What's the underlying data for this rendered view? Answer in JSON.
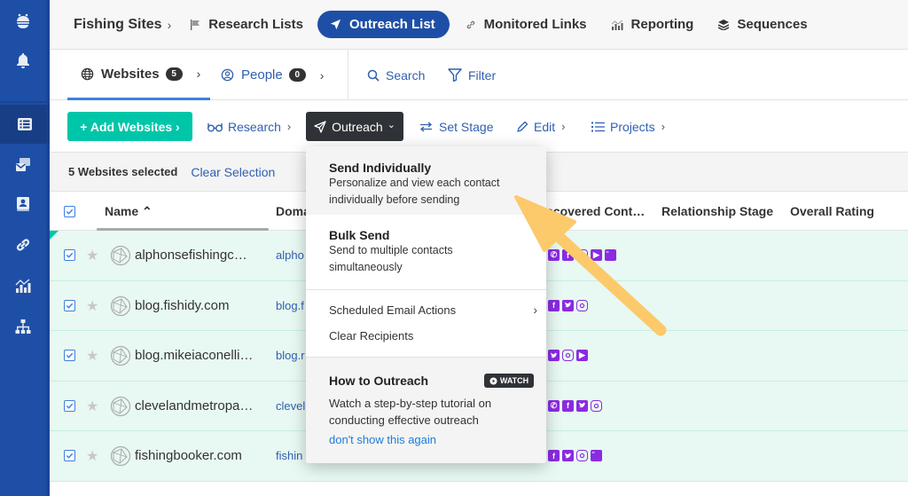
{
  "sidebar": {
    "items": [
      {
        "name": "logo",
        "icon": "logo-icon"
      },
      {
        "name": "notifications",
        "icon": "bell-icon"
      },
      {
        "name": "lists",
        "icon": "list-icon",
        "active": true
      },
      {
        "name": "inbox",
        "icon": "mail-icon"
      },
      {
        "name": "contacts",
        "icon": "contact-book-icon"
      },
      {
        "name": "links",
        "icon": "link-icon"
      },
      {
        "name": "reporting",
        "icon": "chart-icon"
      },
      {
        "name": "sitemap",
        "icon": "sitemap-icon"
      }
    ]
  },
  "topnav": {
    "breadcrumb": "Fishing Sites",
    "breadcrumb_sep": "›",
    "items": [
      {
        "label": "Research Lists",
        "icon": "flag-icon"
      },
      {
        "label": "Outreach List",
        "icon": "paper-plane-icon",
        "active": true
      },
      {
        "label": "Monitored Links",
        "icon": "link-icon"
      },
      {
        "label": "Reporting",
        "icon": "chart-icon"
      },
      {
        "label": "Sequences",
        "icon": "layers-icon"
      }
    ]
  },
  "tabs": {
    "websites": {
      "label": "Websites",
      "count": "5"
    },
    "people": {
      "label": "People",
      "count": "0"
    },
    "chevron": "›",
    "search": "Search",
    "filter": "Filter"
  },
  "actions": {
    "add": "+ Add Websites ›",
    "research": "Research",
    "outreach": "Outreach",
    "set_stage": "Set Stage",
    "edit": "Edit",
    "projects": "Projects",
    "chevron": "›",
    "caret": "⌄"
  },
  "selection": {
    "count_text": "5 Websites selected",
    "clear": "Clear Selection"
  },
  "table": {
    "columns": [
      "Name ⌃",
      "Doma",
      "scovered Cont…",
      "Relationship Stage",
      "Overall Rating"
    ],
    "rows": [
      {
        "name": "alphonsefishingc…",
        "domain": "alpho",
        "contacts": [
          "phone",
          "facebook",
          "instagram",
          "youtube",
          "form"
        ]
      },
      {
        "name": "blog.fishidy.com",
        "domain": "blog.f",
        "contacts": [
          "facebook",
          "twitter",
          "instagram"
        ]
      },
      {
        "name": "blog.mikeiaconelli…",
        "domain": "blog.r",
        "contacts": [
          "twitter",
          "instagram",
          "youtube"
        ]
      },
      {
        "name": "clevelandmetropa…",
        "domain": "clevel",
        "contacts": [
          "phone",
          "facebook",
          "twitter",
          "instagram"
        ]
      },
      {
        "name": "fishingbooker.com",
        "domain": "fishin",
        "contacts": [
          "facebook",
          "twitter",
          "instagram",
          "form"
        ]
      }
    ]
  },
  "dropdown": {
    "send_individually": {
      "title": "Send Individually",
      "desc": "Personalize and view each contact individually before sending"
    },
    "bulk_send": {
      "title": "Bulk Send",
      "desc": "Send to multiple contacts simultaneously"
    },
    "scheduled": "Scheduled Email Actions",
    "scheduled_chevron": "›",
    "clear_recipients": "Clear Recipients",
    "howto": {
      "title": "How to Outreach",
      "watch": "WATCH",
      "desc": "Watch a step-by-step tutorial on conducting effective outreach",
      "dismiss": "don't show this again"
    }
  },
  "colors": {
    "sidebar": "#1e4fa6",
    "accent_teal": "#00c6a9",
    "link_blue": "#2f5fb0",
    "contact_purple": "#8a2be2",
    "row_selected": "#e8f8f2",
    "annotation_arrow": "#fcc96b"
  }
}
